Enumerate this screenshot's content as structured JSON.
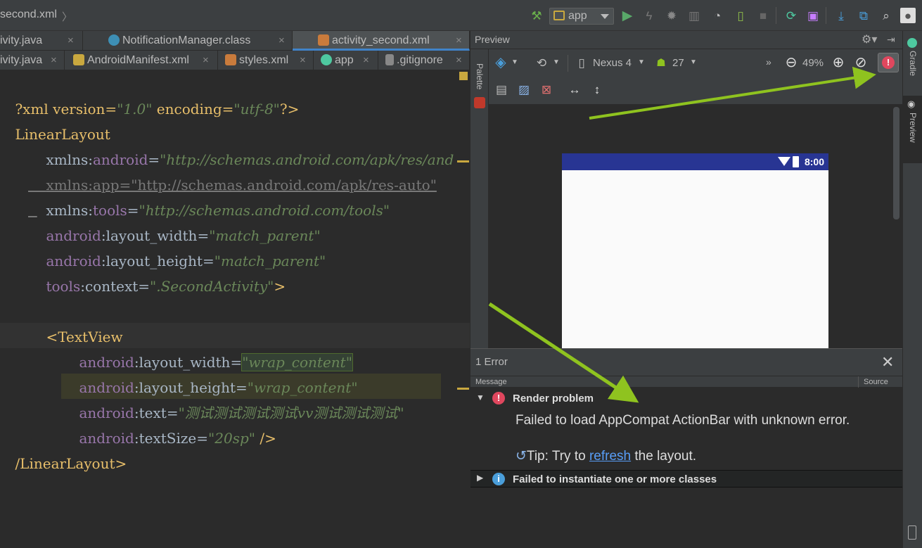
{
  "topbar": {
    "crumb": "second.xml",
    "run_config": "app",
    "icons": [
      "hammer-icon",
      "run-icon",
      "apply-changes-icon",
      "debug-icon",
      "profile-icon",
      "attach-debugger-icon",
      "device-monitor-icon",
      "stop-icon",
      "sync-gradle-icon",
      "sdk-manager-icon",
      "sdk-download-icon",
      "project-structure-icon",
      "search-icon",
      "user-icon"
    ]
  },
  "editor": {
    "tabs_row1": [
      {
        "label": "ivity.java",
        "icon": "java-file-icon"
      },
      {
        "label": "NotificationManager.class",
        "icon": "class-file-icon"
      },
      {
        "label": "activity_second.xml",
        "icon": "xml-file-icon",
        "active": true
      }
    ],
    "tabs_row2": [
      {
        "label": "ivity.java",
        "icon": "java-file-icon"
      },
      {
        "label": "AndroidManifest.xml",
        "icon": "manifest-file-icon"
      },
      {
        "label": "styles.xml",
        "icon": "xml-file-icon"
      },
      {
        "label": "app",
        "icon": "module-icon"
      },
      {
        "label": ".gitignore",
        "icon": "text-file-icon"
      }
    ],
    "close_glyph": "×",
    "code": {
      "l1": {
        "a": "?xml version=",
        "b": "\"1.0\"",
        "c": " encoding=",
        "d": "\"utf-8\"",
        "e": "?>"
      },
      "l2": {
        "a": "LinearLayout"
      },
      "l3": {
        "ns": "xmlns",
        "colon": ":",
        "attr": "android",
        "eq": "=",
        "val": "\"http://schemas.android.com/apk/res/and"
      },
      "l4": {
        "text": "xmlns:app=\"http://schemas.android.com/apk/res-auto\""
      },
      "l5": {
        "ns": "xmlns",
        "colon": ":",
        "attr": "tools",
        "eq": "=",
        "val": "\"http://schemas.android.com/tools\""
      },
      "l6": {
        "ns": "android",
        "colon": ":",
        "attr": "layout_width",
        "eq": "=",
        "val": "\"match_parent\""
      },
      "l7": {
        "ns": "android",
        "colon": ":",
        "attr": "layout_height",
        "eq": "=",
        "val": "\"match_parent\""
      },
      "l8": {
        "ns": "tools",
        "colon": ":",
        "attr": "context",
        "eq": "=",
        "val": "\".SecondActivity\"",
        "end": ">"
      },
      "l10": {
        "a": "<",
        "b": "TextView"
      },
      "l11": {
        "ns": "android",
        "colon": ":",
        "attr": "layout_width",
        "eq": "=",
        "val": "\"wrap_content\""
      },
      "l12": {
        "ns": "android",
        "colon": ":",
        "attr": "layout_height",
        "eq": "=",
        "val": "\"wrap_content\""
      },
      "l13": {
        "ns": "android",
        "colon": ":",
        "attr": "text",
        "eq": "=",
        "val": "\"测试测试测试测试vv测试测试测试\""
      },
      "l14": {
        "ns": "android",
        "colon": ":",
        "attr": "textSize",
        "eq": "=",
        "val": "\"20sp\"",
        "end": " />"
      },
      "l15": {
        "a": "/LinearLayout",
        "b": ">"
      }
    }
  },
  "preview": {
    "title": "Preview",
    "palette_label": "Palette",
    "device": "Nexus 4",
    "api": "27",
    "zoom": "49%",
    "phone_time": "8:00",
    "colors": {
      "status_bar": "#283593",
      "error": "#e0475e",
      "arrow": "#8fc31f"
    }
  },
  "errors": {
    "title": "1 Error",
    "col_message": "Message",
    "col_source": "Source",
    "items": [
      {
        "title": "Render problem",
        "message": "Failed to load AppCompat ActionBar with unknown error.",
        "tip_prefix": "Tip: Try to ",
        "tip_link": "refresh",
        "tip_suffix": " the layout."
      },
      {
        "title": "Failed to instantiate one or more classes"
      }
    ]
  },
  "right_strip": {
    "gradle": "Gradle",
    "preview": "Preview"
  }
}
